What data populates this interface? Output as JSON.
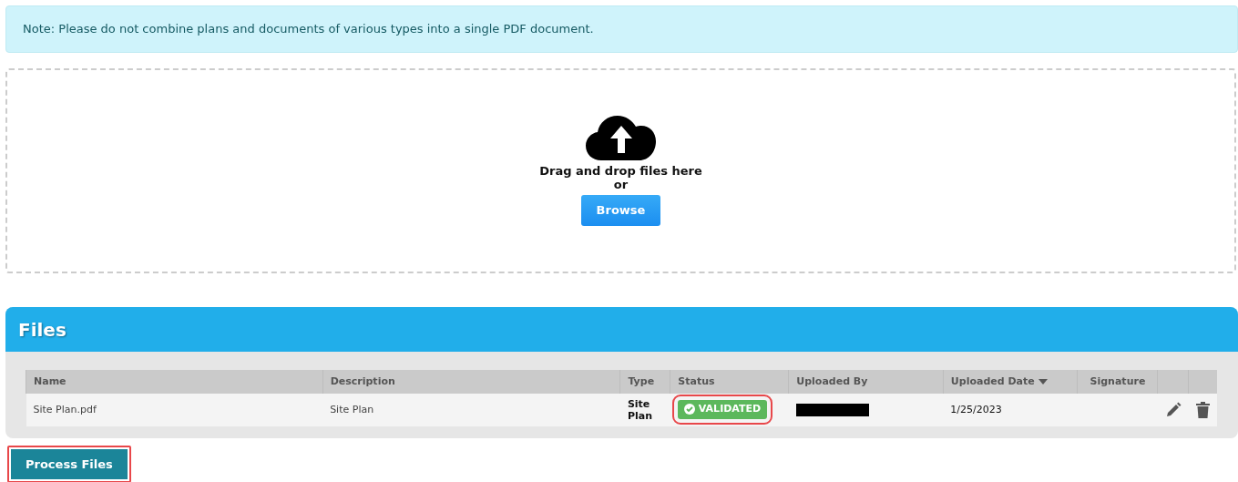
{
  "note": "Note: Please do not combine plans and documents of various types into a single PDF document.",
  "dropzone": {
    "prompt": "Drag and drop files here",
    "or": "or",
    "button": "Browse"
  },
  "files": {
    "title": "Files",
    "columns": [
      {
        "label": "Name",
        "sorted": false
      },
      {
        "label": "Description",
        "sorted": false
      },
      {
        "label": "Type",
        "sorted": false
      },
      {
        "label": "Status",
        "sorted": false
      },
      {
        "label": "Uploaded By",
        "sorted": false
      },
      {
        "label": "Uploaded Date",
        "sorted": true
      },
      {
        "label": "Signature",
        "sorted": false
      }
    ],
    "rows": [
      {
        "name": "Site Plan.pdf",
        "description": "Site Plan",
        "type": "Site Plan",
        "status": "VALIDATED",
        "status_highlighted": true,
        "uploaded_by_redacted": true,
        "uploaded_date": "1/25/2023"
      }
    ]
  },
  "process_button": {
    "label": "Process Files",
    "highlighted": true
  }
}
